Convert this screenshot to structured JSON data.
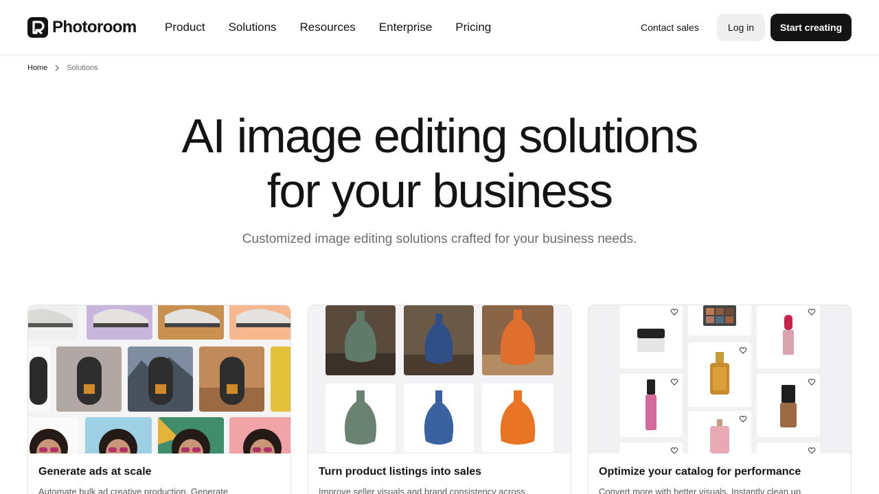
{
  "brand": {
    "name": "Photoroom"
  },
  "nav": {
    "items": [
      "Product",
      "Solutions",
      "Resources",
      "Enterprise",
      "Pricing"
    ],
    "contact": "Contact sales",
    "login": "Log in",
    "start": "Start creating"
  },
  "breadcrumb": {
    "home": "Home",
    "current": "Solutions"
  },
  "hero": {
    "title_line1": "AI image editing solutions",
    "title_line2": "for your business",
    "subtitle": "Customized image editing solutions crafted for your business needs."
  },
  "cards": [
    {
      "title": "Generate ads at scale",
      "desc": "Automate bulk ad creative production. Generate"
    },
    {
      "title": "Turn product listings into sales",
      "desc": "Improve seller visuals and brand consistency across"
    },
    {
      "title": "Optimize your catalog for performance",
      "desc": "Convert more with better visuals. Instantly clean up"
    }
  ],
  "colors": {
    "ink": "#141414",
    "muted": "#6e6e6e",
    "login_bg": "#efefef",
    "start_bg": "#141414"
  }
}
